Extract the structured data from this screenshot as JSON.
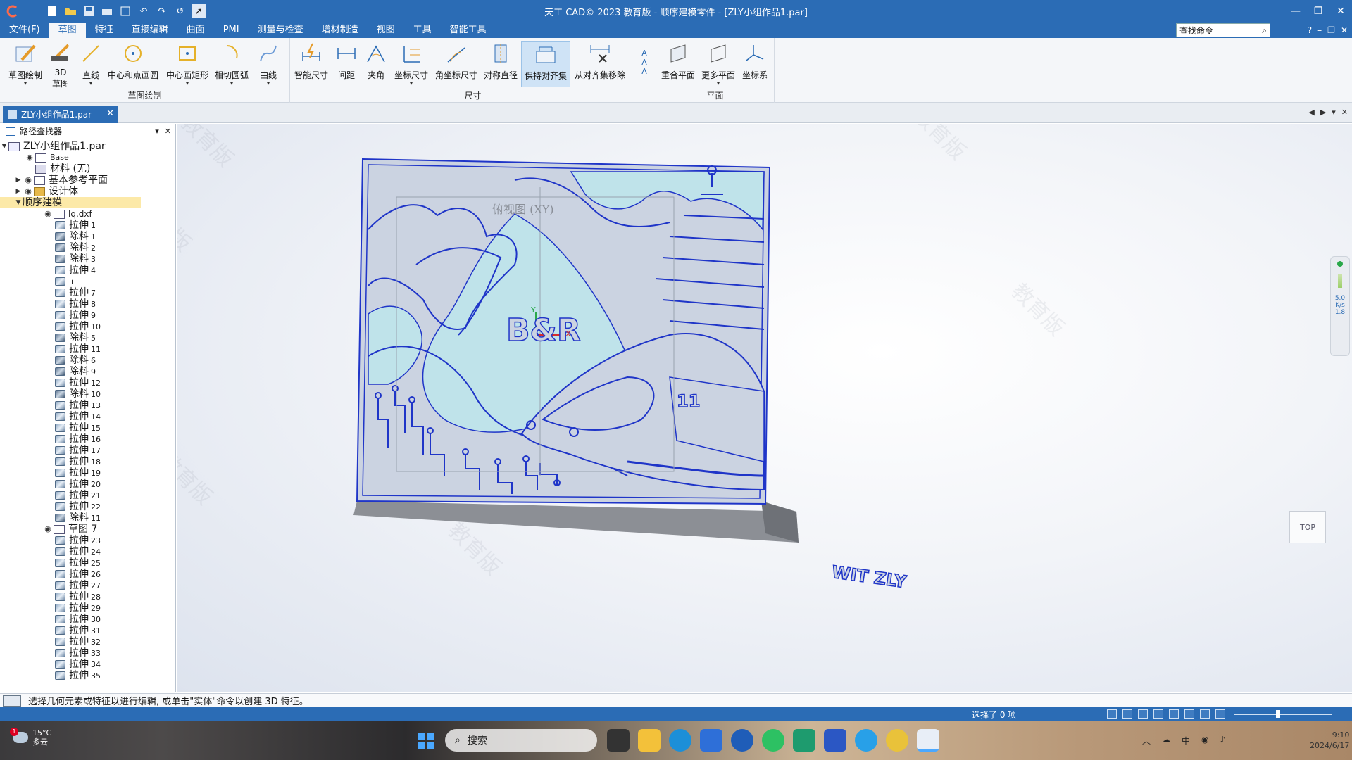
{
  "window": {
    "title": "天工 CAD© 2023 教育版 - 顺序建模零件 - [ZLY小组作品1.par]"
  },
  "menubar": {
    "items": [
      "文件(F)",
      "草图",
      "特征",
      "直接编辑",
      "曲面",
      "PMI",
      "测量与检查",
      "增材制造",
      "视图",
      "工具",
      "智能工具"
    ],
    "active_index": 1,
    "search_placeholder": "查找命令"
  },
  "ribbon": {
    "groups": [
      {
        "name": "草图绘制",
        "buttons": [
          {
            "label": "草图绘制",
            "icon": "sketch-pencil-icon"
          },
          {
            "label": "3D草图",
            "icon": "3d-sketch-icon"
          },
          {
            "label": "直线",
            "icon": "line-icon"
          },
          {
            "label": "中心和点画圆",
            "icon": "circle-icon"
          },
          {
            "label": "中心画矩形",
            "icon": "rectangle-icon"
          },
          {
            "label": "相切圆弧",
            "icon": "arc-icon"
          },
          {
            "label": "曲线",
            "icon": "curve-icon"
          }
        ]
      },
      {
        "name": "尺寸",
        "buttons": [
          {
            "label": "智能尺寸",
            "icon": "smart-dimension-icon"
          },
          {
            "label": "间距",
            "icon": "distance-icon"
          },
          {
            "label": "夹角",
            "icon": "angle-icon"
          },
          {
            "label": "坐标尺寸",
            "icon": "coordinate-dimension-icon"
          },
          {
            "label": "角坐标尺寸",
            "icon": "angular-coordinate-icon"
          },
          {
            "label": "对称直径",
            "icon": "symmetric-diameter-icon"
          },
          {
            "label": "保持对齐集",
            "icon": "keep-align-icon"
          },
          {
            "label": "从对齐集移除",
            "icon": "remove-align-icon"
          }
        ]
      },
      {
        "name": "平面",
        "buttons": [
          {
            "label": "重合平面",
            "icon": "coincident-plane-icon"
          },
          {
            "label": "更多平面",
            "icon": "more-planes-icon"
          },
          {
            "label": "坐标系",
            "icon": "coordinate-system-icon"
          }
        ]
      }
    ]
  },
  "doc_tab": {
    "label": "ZLY小组作品1.par"
  },
  "pathfinder": {
    "title": "路径查找器",
    "root": "ZLY小组作品1.par",
    "top_items": [
      {
        "label": "Base"
      },
      {
        "label": "材料 (无)"
      },
      {
        "label": "基本参考平面"
      },
      {
        "label": "设计体"
      },
      {
        "label": "顺序建模"
      }
    ],
    "sketch1": "lq.dxf",
    "features1": [
      {
        "name": "拉伸",
        "num": "1",
        "type": "extrude"
      },
      {
        "name": "除料",
        "num": "1",
        "type": "cut"
      },
      {
        "name": "除料",
        "num": "2",
        "type": "cut"
      },
      {
        "name": "除料",
        "num": "3",
        "type": "cut"
      },
      {
        "name": "拉伸",
        "num": "4",
        "type": "extrude"
      },
      {
        "name": "",
        "num": "i",
        "type": "extrude"
      },
      {
        "name": "拉伸",
        "num": "7",
        "type": "extrude"
      },
      {
        "name": "拉伸",
        "num": "8",
        "type": "extrude"
      },
      {
        "name": "拉伸",
        "num": "9",
        "type": "extrude"
      },
      {
        "name": "拉伸",
        "num": "10",
        "type": "extrude"
      },
      {
        "name": "除料",
        "num": "5",
        "type": "cut"
      },
      {
        "name": "拉伸",
        "num": "11",
        "type": "extrude"
      },
      {
        "name": "除料",
        "num": "6",
        "type": "cut"
      },
      {
        "name": "除料",
        "num": "9",
        "type": "cut"
      },
      {
        "name": "拉伸",
        "num": "12",
        "type": "extrude"
      },
      {
        "name": "除料",
        "num": "10",
        "type": "cut"
      },
      {
        "name": "拉伸",
        "num": "13",
        "type": "extrude"
      },
      {
        "name": "拉伸",
        "num": "14",
        "type": "extrude"
      },
      {
        "name": "拉伸",
        "num": "15",
        "type": "extrude"
      },
      {
        "name": "拉伸",
        "num": "16",
        "type": "extrude"
      },
      {
        "name": "拉伸",
        "num": "17",
        "type": "extrude"
      },
      {
        "name": "拉伸",
        "num": "18",
        "type": "extrude"
      },
      {
        "name": "拉伸",
        "num": "19",
        "type": "extrude"
      },
      {
        "name": "拉伸",
        "num": "20",
        "type": "extrude"
      },
      {
        "name": "拉伸",
        "num": "21",
        "type": "extrude"
      },
      {
        "name": "拉伸",
        "num": "22",
        "type": "extrude"
      },
      {
        "name": "除料",
        "num": "11",
        "type": "cut"
      }
    ],
    "sketch2": "草图 7",
    "features2": [
      {
        "name": "拉伸",
        "num": "23"
      },
      {
        "name": "拉伸",
        "num": "24"
      },
      {
        "name": "拉伸",
        "num": "25"
      },
      {
        "name": "拉伸",
        "num": "26"
      },
      {
        "name": "拉伸",
        "num": "27"
      },
      {
        "name": "拉伸",
        "num": "28"
      },
      {
        "name": "拉伸",
        "num": "29"
      },
      {
        "name": "拉伸",
        "num": "30"
      },
      {
        "name": "拉伸",
        "num": "31"
      },
      {
        "name": "拉伸",
        "num": "32"
      },
      {
        "name": "拉伸",
        "num": "33"
      },
      {
        "name": "拉伸",
        "num": "34"
      },
      {
        "name": "拉伸",
        "num": "35"
      }
    ]
  },
  "viewport": {
    "view_label": "俯视图 (XY)",
    "model_text_number": "11",
    "model_text_brand": "B&R",
    "model_text_sign": "WIT ZLY",
    "axis_x": "X",
    "axis_y": "Y",
    "view_cube": "TOP",
    "watermark": "教育版",
    "meter_values": [
      "5.0",
      "1.8"
    ],
    "meter_unit": "K/s"
  },
  "prompt": {
    "text": "选择几何元素或特征以进行编辑, 或单击\"实体\"命令以创建 3D 特征。"
  },
  "status": {
    "selection": "选择了 0 项"
  },
  "taskbar": {
    "weather_temp": "15°C",
    "weather_desc": "多云",
    "weather_badge": "1",
    "search_label": "搜索",
    "ime": "中",
    "time": "9:10",
    "date": "2024/6/17"
  },
  "colors": {
    "accent": "#2b6cb5",
    "model_face": "#cbd3e1",
    "model_cyan": "#bfe3ea",
    "model_edge": "#1f35c8",
    "ribbon_bg": "#f4f6f9"
  }
}
